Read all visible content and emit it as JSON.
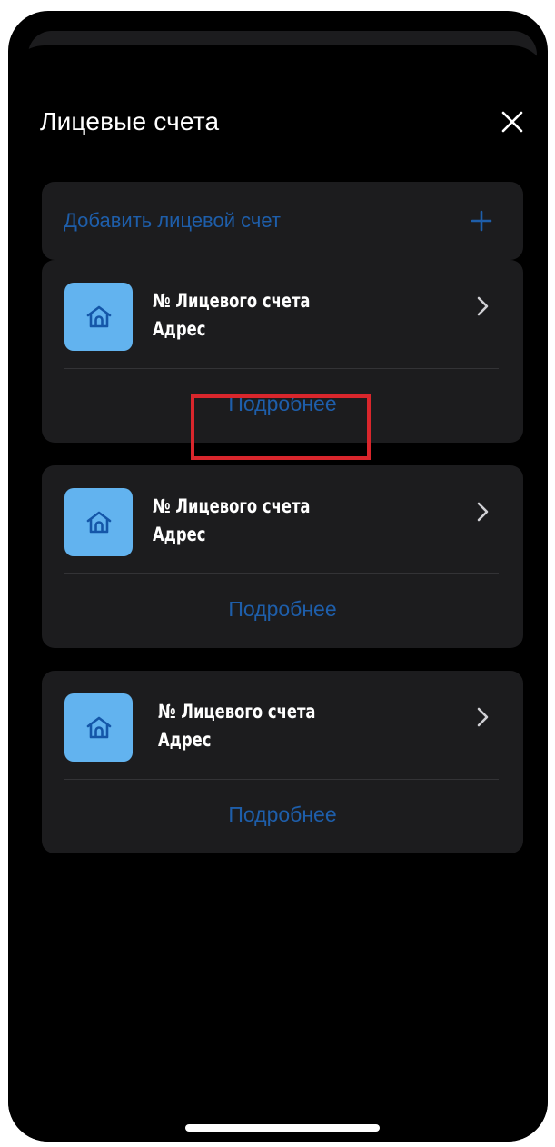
{
  "header": {
    "title": "Лицевые счета",
    "close_icon": "close-icon"
  },
  "add_account": {
    "label": "Добавить лицевой счет",
    "icon": "plus-icon"
  },
  "accounts": [
    {
      "number_label": "№ Лицевого счета",
      "address_label": "Адрес",
      "details_label": "Подробнее",
      "icon": "home-icon"
    },
    {
      "number_label": "№ Лицевого счета",
      "address_label": "Адрес",
      "details_label": "Подробнее",
      "icon": "home-icon"
    },
    {
      "number_label": "№ Лицевого счета",
      "address_label": "Адрес",
      "details_label": "Подробнее",
      "icon": "home-icon"
    }
  ],
  "colors": {
    "background": "#000000",
    "card": "#1c1c1e",
    "accent_link": "#1e5eaa",
    "icon_tile": "#62b3ef",
    "highlight": "#d9262c"
  }
}
